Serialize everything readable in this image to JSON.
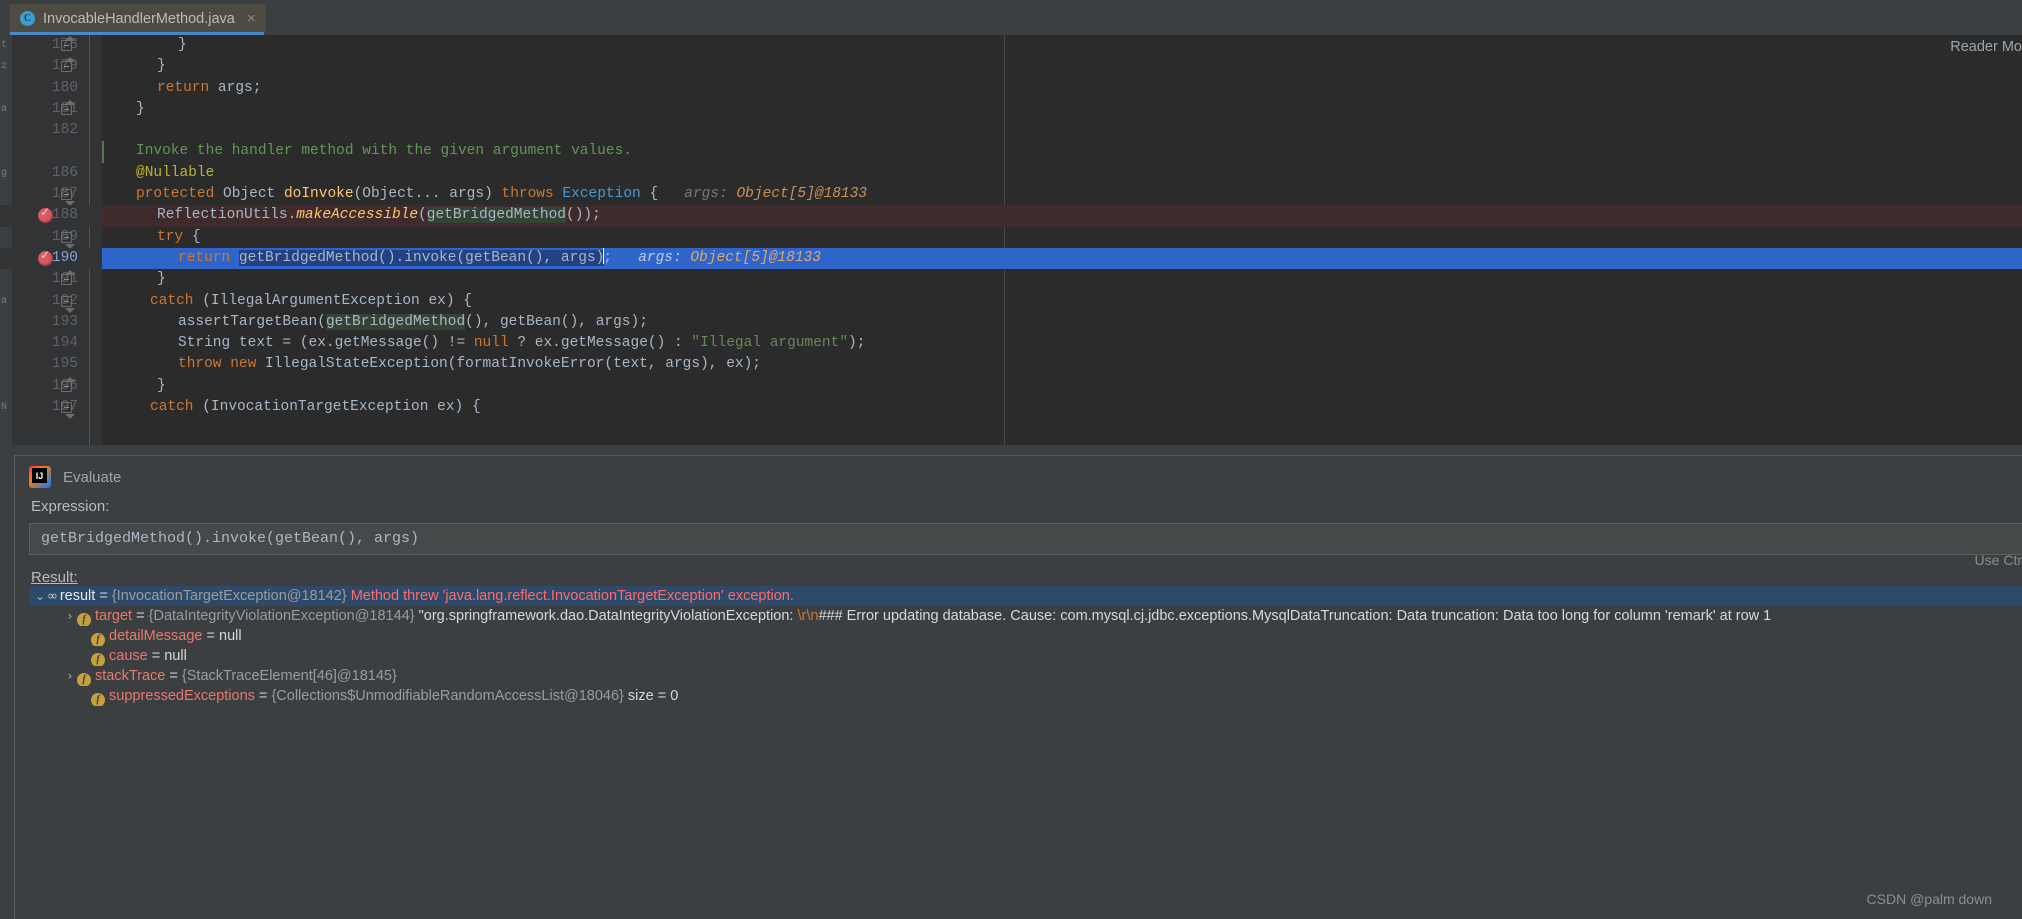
{
  "tab": {
    "title": "InvocableHandlerMethod.java",
    "icon": "java-class-icon",
    "close": "×"
  },
  "editor": {
    "reader_mode": "Reader Mo",
    "doc_comment": "Invoke the handler method with the given argument values.",
    "lines": [
      {
        "num": "178",
        "fold": "cap",
        "breakpoint": false,
        "state": "normal",
        "indent": 76,
        "tokens": [
          {
            "t": "}",
            "c": "pl"
          }
        ]
      },
      {
        "num": "179",
        "fold": "cap",
        "breakpoint": false,
        "state": "normal",
        "indent": 55,
        "tokens": [
          {
            "t": "}",
            "c": "pl"
          }
        ]
      },
      {
        "num": "180",
        "fold": "none",
        "breakpoint": false,
        "state": "normal",
        "indent": 55,
        "tokens": [
          {
            "t": "return ",
            "c": "kw"
          },
          {
            "t": "args;",
            "c": "pl"
          }
        ]
      },
      {
        "num": "181",
        "fold": "cap",
        "breakpoint": false,
        "state": "normal",
        "indent": 34,
        "tokens": [
          {
            "t": "}",
            "c": "pl"
          }
        ]
      },
      {
        "num": "182",
        "fold": "none",
        "breakpoint": false,
        "state": "normal",
        "indent": 0,
        "tokens": []
      },
      {
        "num": "",
        "fold": "none",
        "breakpoint": false,
        "state": "doc",
        "indent": 34,
        "tokens": [
          {
            "t": "Invoke the handler method with the given argument values.",
            "c": "doc"
          }
        ]
      },
      {
        "num": "186",
        "fold": "none",
        "breakpoint": false,
        "state": "normal",
        "indent": 34,
        "tokens": [
          {
            "t": "@Nullable",
            "c": "an"
          }
        ]
      },
      {
        "num": "187",
        "fold": "dn",
        "breakpoint": false,
        "state": "normal",
        "indent": 34,
        "tokens": [
          {
            "t": "protected ",
            "c": "kw"
          },
          {
            "t": "Object ",
            "c": "pl"
          },
          {
            "t": "doInvoke",
            "c": "mth"
          },
          {
            "t": "(Object... args) ",
            "c": "pl"
          },
          {
            "t": "throws ",
            "c": "kw"
          },
          {
            "t": "Exception",
            "c": "cls"
          },
          {
            "t": " {",
            "c": "pl"
          },
          {
            "t": "   args: ",
            "c": "hint"
          },
          {
            "t": "Object[5]@18133",
            "c": "hintv"
          }
        ]
      },
      {
        "num": "188",
        "fold": "none",
        "breakpoint": true,
        "state": "bpline",
        "indent": 55,
        "tokens": [
          {
            "t": "ReflectionUtils.",
            "c": "pl"
          },
          {
            "t": "makeAccessible",
            "c": "mth itl"
          },
          {
            "t": "(",
            "c": "pl"
          },
          {
            "t": "getBridgedMethod",
            "c": "pl hl"
          },
          {
            "t": "());",
            "c": "pl"
          }
        ]
      },
      {
        "num": "189",
        "fold": "dn",
        "breakpoint": false,
        "state": "normal",
        "indent": 55,
        "tokens": [
          {
            "t": "try ",
            "c": "kw"
          },
          {
            "t": "{",
            "c": "pl"
          }
        ]
      },
      {
        "num": "190",
        "fold": "none",
        "breakpoint": true,
        "state": "selline",
        "indent": 76,
        "tokens": [
          {
            "t": "return ",
            "c": "kw"
          },
          {
            "t": "getBridgedMethod().invoke(getBean(), args)",
            "c": "pl selhl"
          },
          {
            "t": "CARET",
            "c": "caret"
          },
          {
            "t": ";",
            "c": "pl"
          },
          {
            "t": "   args: ",
            "c": "selhint"
          },
          {
            "t": "Object[5]@18133",
            "c": "selhintv"
          }
        ]
      },
      {
        "num": "191",
        "fold": "cap",
        "breakpoint": false,
        "state": "normal",
        "indent": 55,
        "tokens": [
          {
            "t": "}",
            "c": "pl"
          }
        ]
      },
      {
        "num": "192",
        "fold": "dn",
        "breakpoint": false,
        "state": "normal",
        "indent": 48,
        "tokens": [
          {
            "t": "catch ",
            "c": "kw"
          },
          {
            "t": "(IllegalArgumentException ex) {",
            "c": "pl"
          }
        ]
      },
      {
        "num": "193",
        "fold": "none",
        "breakpoint": false,
        "state": "normal",
        "indent": 76,
        "tokens": [
          {
            "t": "assertTargetBean(",
            "c": "pl"
          },
          {
            "t": "getBridgedMethod",
            "c": "pl hl"
          },
          {
            "t": "(), getBean(), args);",
            "c": "pl"
          }
        ]
      },
      {
        "num": "194",
        "fold": "none",
        "breakpoint": false,
        "state": "normal",
        "indent": 76,
        "tokens": [
          {
            "t": "String text = (ex.getMessage() != ",
            "c": "pl"
          },
          {
            "t": "null",
            "c": "kw"
          },
          {
            "t": " ? ex.getMessage() : ",
            "c": "pl"
          },
          {
            "t": "\"Illegal argument\"",
            "c": "str"
          },
          {
            "t": ");",
            "c": "pl"
          }
        ]
      },
      {
        "num": "195",
        "fold": "none",
        "breakpoint": false,
        "state": "normal",
        "indent": 76,
        "tokens": [
          {
            "t": "throw new ",
            "c": "kw"
          },
          {
            "t": "IllegalStateException(formatInvokeError(text, args), ex);",
            "c": "pl"
          }
        ]
      },
      {
        "num": "196",
        "fold": "cap",
        "breakpoint": false,
        "state": "normal",
        "indent": 55,
        "tokens": [
          {
            "t": "}",
            "c": "pl"
          }
        ]
      },
      {
        "num": "197",
        "fold": "dn",
        "breakpoint": false,
        "state": "normal",
        "indent": 48,
        "tokens": [
          {
            "t": "catch ",
            "c": "kw"
          },
          {
            "t": "(InvocationTargetException ex) {",
            "c": "pl"
          }
        ]
      }
    ]
  },
  "evaluate": {
    "title": "Evaluate",
    "icon": "intellij-logo-icon",
    "expression_label": "Expression:",
    "expression_value": "getBridgedMethod().invoke(getBean(), args)",
    "use_ctrl_hint": "Use Ctr",
    "result_label": "Result:",
    "tree": [
      {
        "indent": 1,
        "selected": true,
        "expanded": true,
        "twisty": "⌄",
        "icon": "infinity-icon",
        "icon_glyph": "∞",
        "name": "result",
        "name_color": "white",
        "ref": "{InvocationTargetException@18142}",
        "value": "Method threw 'java.lang.reflect.InvocationTargetException' exception.",
        "value_color": "error"
      },
      {
        "indent": 2,
        "selected": false,
        "expanded": false,
        "twisty": "›",
        "icon": "field-icon",
        "icon_glyph": "f",
        "name": "target",
        "name_color": "red",
        "ref": "{DataIntegrityViolationException@18144}",
        "value": "\"org.springframework.dao.DataIntegrityViolationException: \\r\\n### Error updating database.  Cause: com.mysql.cj.jdbc.exceptions.MysqlDataTruncation: Data truncation: Data too long for column 'remark' at row 1",
        "value_color": "string",
        "escape": "\\r\\n"
      },
      {
        "indent": 3,
        "selected": false,
        "expanded": false,
        "twisty": "",
        "icon": "field-icon",
        "icon_glyph": "f",
        "name": "detailMessage",
        "name_color": "red",
        "ref": "",
        "value": "null",
        "value_color": "plain"
      },
      {
        "indent": 3,
        "selected": false,
        "expanded": false,
        "twisty": "",
        "icon": "field-icon",
        "icon_glyph": "f",
        "name": "cause",
        "name_color": "red",
        "ref": "",
        "value": "null",
        "value_color": "plain"
      },
      {
        "indent": 2,
        "selected": false,
        "expanded": false,
        "twisty": "›",
        "icon": "field-icon",
        "icon_glyph": "f",
        "name": "stackTrace",
        "name_color": "red",
        "ref": "{StackTraceElement[46]@18145}",
        "value": "",
        "value_color": "plain"
      },
      {
        "indent": 3,
        "selected": false,
        "expanded": false,
        "twisty": "",
        "icon": "field-icon",
        "icon_glyph": "f",
        "name": "suppressedExceptions",
        "name_color": "red",
        "ref": "{Collections$UnmodifiableRandomAccessList@18046}",
        "value": "size = 0",
        "value_color": "size"
      }
    ]
  },
  "watermark": "CSDN @palm down",
  "colors": {
    "editor_bg": "#2b2b2b",
    "panel_bg": "#3c3f41",
    "gutter_bg": "#313335",
    "selection_blue": "#2f65ca",
    "breakpoint_red": "#db5860",
    "breakpoint_line_bg": "#3f2b2c",
    "tab_accent": "#4a88c7",
    "keyword_orange": "#cc7832",
    "string_green": "#6a8759",
    "annotation_yellow": "#bbb529",
    "method_gold": "#ffc66d",
    "error_red": "#ff6b68",
    "field_gold": "#c6a03c"
  }
}
